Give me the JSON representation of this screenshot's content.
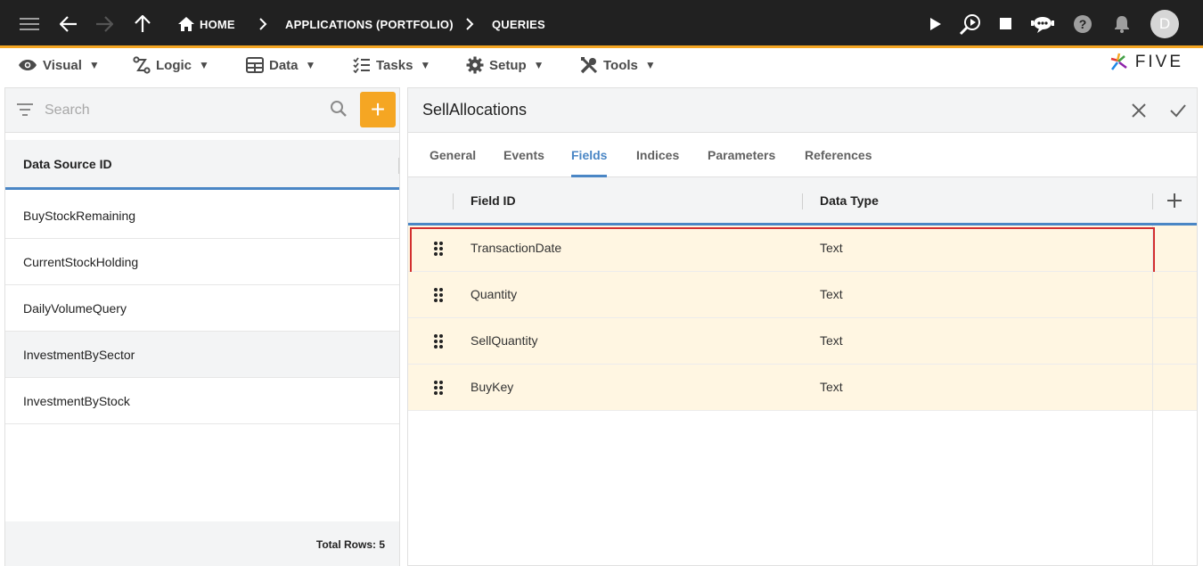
{
  "topbar": {
    "breadcrumbs": [
      "HOME",
      "APPLICATIONS (PORTFOLIO)",
      "QUERIES"
    ],
    "avatar_initial": "D",
    "icons": [
      "menu-icon",
      "back-arrow-icon",
      "forward-arrow-icon",
      "up-arrow-icon",
      "home-icon",
      "chevron-right-icon",
      "play-icon",
      "debug-search-icon",
      "stop-icon",
      "chat-bot-icon",
      "help-icon",
      "bell-icon"
    ],
    "accent_color": "#f5a623"
  },
  "menubar": {
    "items": [
      {
        "label": "Visual",
        "icon": "eye-icon"
      },
      {
        "label": "Logic",
        "icon": "logic-flow-icon"
      },
      {
        "label": "Data",
        "icon": "table-icon"
      },
      {
        "label": "Tasks",
        "icon": "checklist-icon"
      },
      {
        "label": "Setup",
        "icon": "gear-icon"
      },
      {
        "label": "Tools",
        "icon": "tools-icon"
      }
    ],
    "caret": "▼",
    "logo_text": "FIVE"
  },
  "left_panel": {
    "search_placeholder": "Search",
    "add_label": "+",
    "column_header": "Data Source ID",
    "rows": [
      "BuyStockRemaining",
      "CurrentStockHolding",
      "DailyVolumeQuery",
      "InvestmentBySector",
      "InvestmentByStock"
    ],
    "footer": "Total Rows: 5"
  },
  "right_panel": {
    "title": "SellAllocations",
    "tabs": [
      "General",
      "Events",
      "Fields",
      "Indices",
      "Parameters",
      "References"
    ],
    "active_tab": "Fields",
    "columns": [
      "Field ID",
      "Data Type"
    ],
    "add_label": "+",
    "rows": [
      {
        "field_id": "TransactionDate",
        "data_type": "Text",
        "selected": true
      },
      {
        "field_id": "Quantity",
        "data_type": "Text",
        "selected": false
      },
      {
        "field_id": "SellQuantity",
        "data_type": "Text",
        "selected": false
      },
      {
        "field_id": "BuyKey",
        "data_type": "Text",
        "selected": false
      }
    ],
    "colors": {
      "active_tab": "#4a86c5",
      "row_highlight": "#fff6e2",
      "selected_border": "#d32f2f"
    }
  }
}
